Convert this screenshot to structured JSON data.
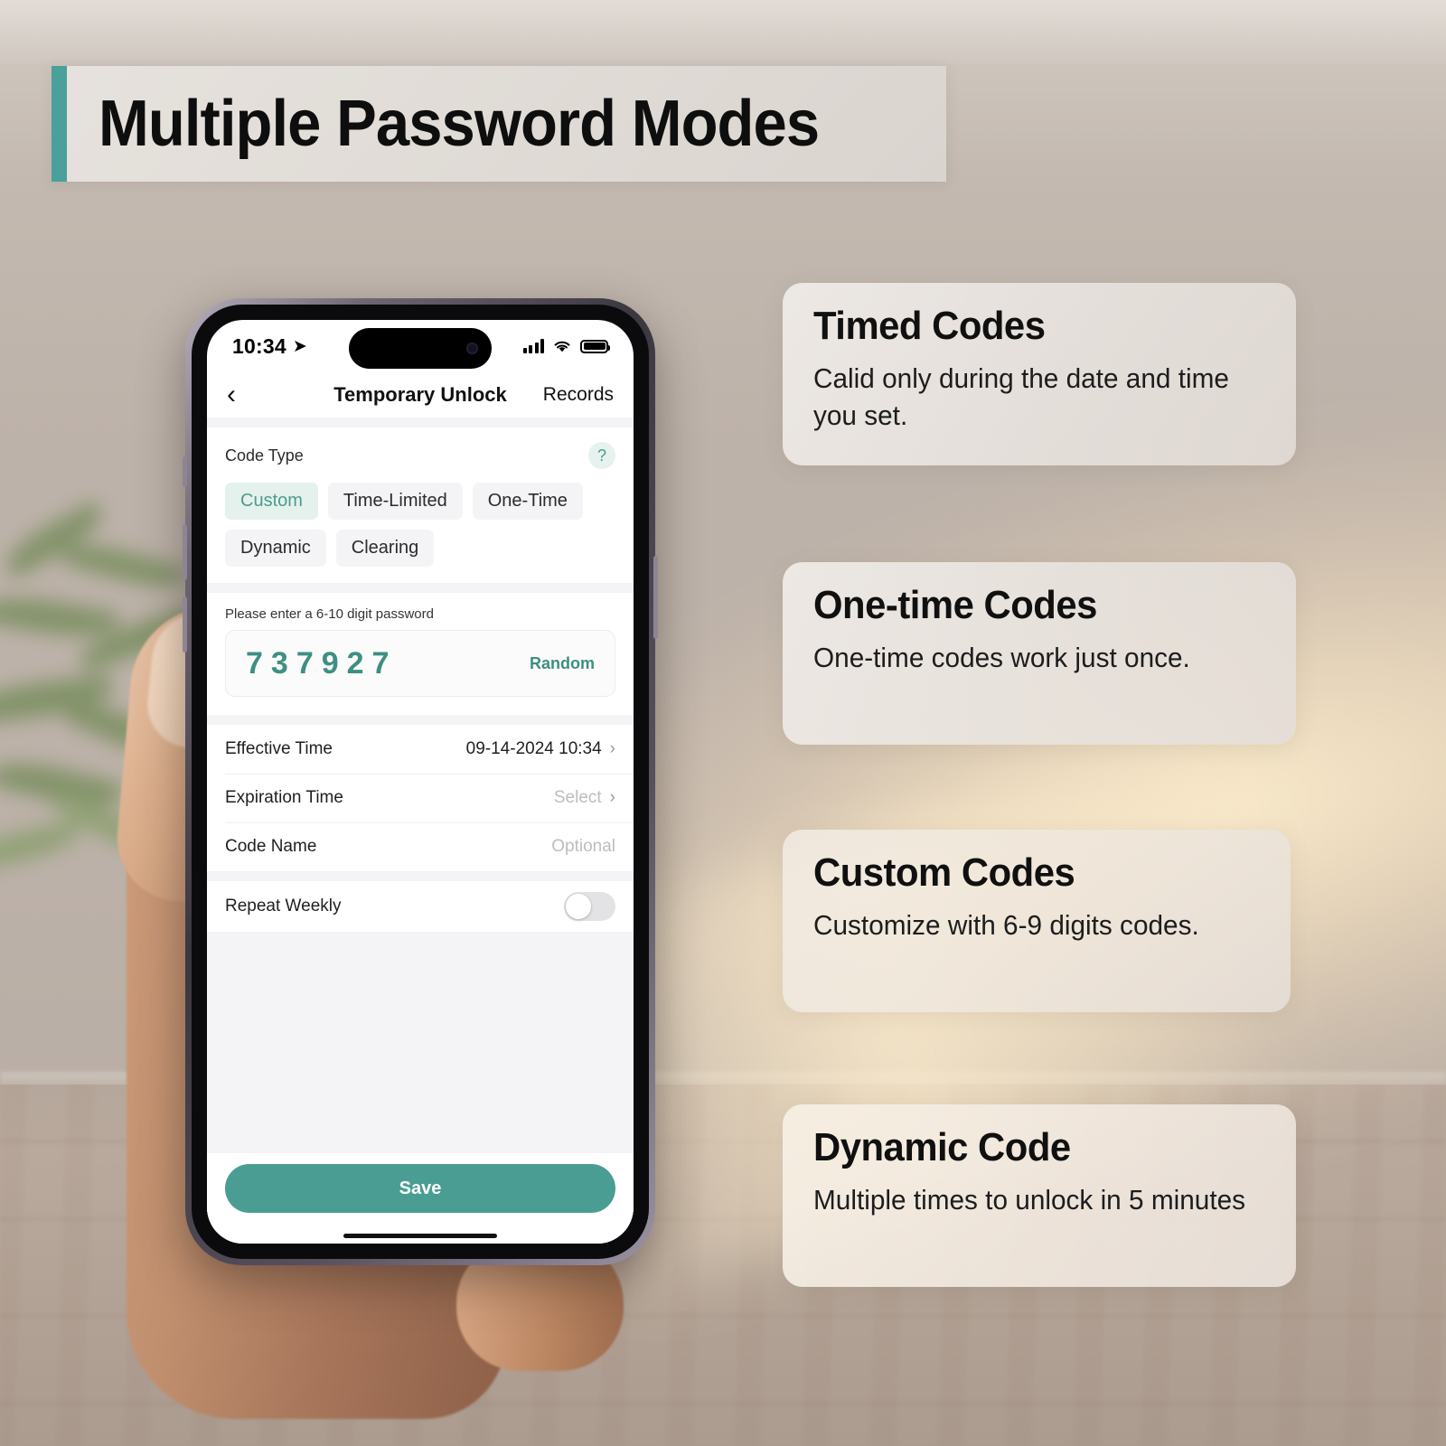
{
  "banner": {
    "title": "Multiple Password Modes",
    "accent_color": "#4aa09a"
  },
  "phone": {
    "status_bar": {
      "time": "10:34",
      "location_icon": "location-arrow-icon",
      "signal_icon": "cellular-signal-icon",
      "wifi_icon": "wifi-icon",
      "battery_icon": "battery-icon"
    },
    "nav": {
      "back_icon": "chevron-left-icon",
      "title": "Temporary Unlock",
      "records_label": "Records"
    },
    "code_type": {
      "label": "Code Type",
      "help_icon": "question-mark-icon",
      "help_glyph": "?",
      "options": [
        {
          "label": "Custom",
          "active": true
        },
        {
          "label": "Time-Limited",
          "active": false
        },
        {
          "label": "One-Time",
          "active": false
        },
        {
          "label": "Dynamic",
          "active": false
        },
        {
          "label": "Clearing",
          "active": false
        }
      ]
    },
    "password": {
      "hint": "Please enter a 6-10 digit password",
      "value": "737927",
      "random_label": "Random",
      "accent_color": "#3d8f82"
    },
    "rows": [
      {
        "label": "Effective Time",
        "value": "09-14-2024 10:34",
        "muted": false,
        "chevron": "›"
      },
      {
        "label": "Expiration Time",
        "value": "Select",
        "muted": true,
        "chevron": "›"
      },
      {
        "label": "Code Name",
        "value": "Optional",
        "muted": true,
        "chevron": ""
      }
    ],
    "repeat_weekly": {
      "label": "Repeat Weekly",
      "enabled": false
    },
    "save_label": "Save",
    "save_color": "#4a9d93"
  },
  "features": [
    {
      "title": "Timed Codes",
      "body": "Calid only during the date and time you set."
    },
    {
      "title": "One-time Codes",
      "body": "One-time codes work just once."
    },
    {
      "title": "Custom Codes",
      "body": "Customize with 6-9 digits codes."
    },
    {
      "title": "Dynamic Code",
      "body": "Multiple times to unlock in 5 minutes"
    }
  ]
}
